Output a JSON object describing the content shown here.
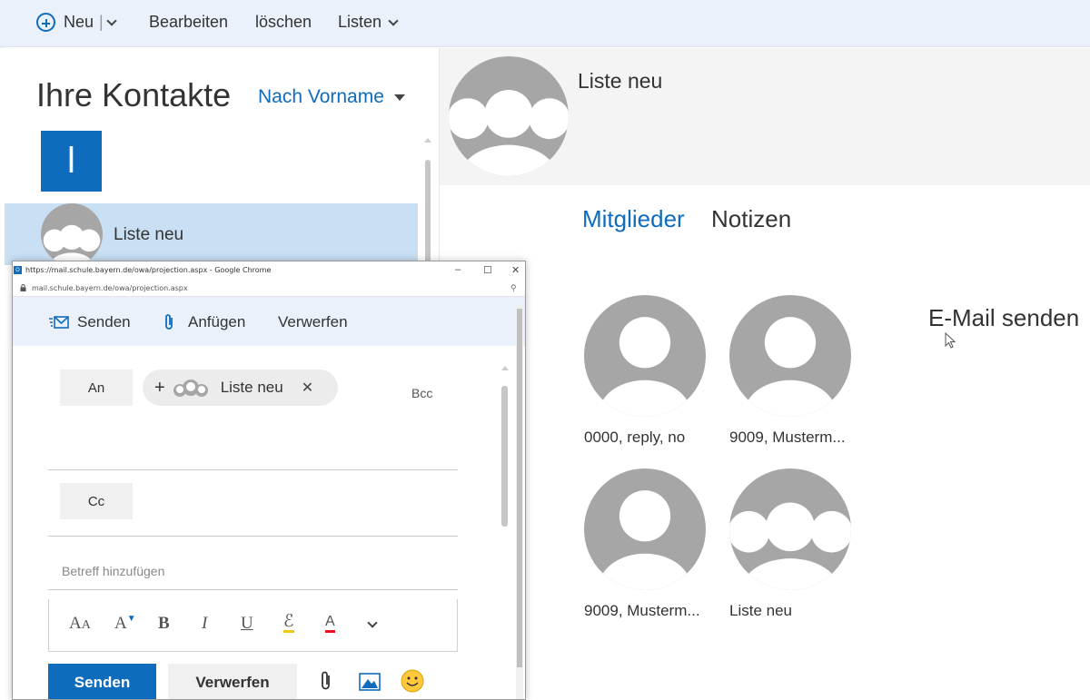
{
  "toolbar": {
    "new_label": "Neu",
    "edit_label": "Bearbeiten",
    "delete_label": "löschen",
    "lists_label": "Listen"
  },
  "contacts": {
    "heading": "Ihre Kontakte",
    "sort_label": "Nach Vorname",
    "letter": "l",
    "items": [
      {
        "name": "Liste neu",
        "avatar": "group-icon"
      }
    ]
  },
  "detail": {
    "title": "Liste neu",
    "tabs": [
      {
        "label": "Mitglieder"
      },
      {
        "label": "Notizen"
      }
    ],
    "send_mail_label": "E-Mail senden",
    "members": [
      {
        "name": "0000, reply, no",
        "avatar": "person-icon"
      },
      {
        "name": "9009, Musterm...",
        "avatar": "person-icon"
      },
      {
        "name": "9009, Musterm...",
        "avatar": "person-icon"
      },
      {
        "name": "Liste neu",
        "avatar": "group-icon"
      }
    ]
  },
  "popup": {
    "window_title": "https://mail.schule.bayern.de/owa/projection.aspx - Google Chrome",
    "url": "mail.schule.bayern.de/owa/projection.aspx",
    "commands": {
      "send": "Senden",
      "attach": "Anfügen",
      "discard": "Verwerfen"
    },
    "to_label": "An",
    "cc_label": "Cc",
    "bcc_label": "Bcc",
    "recipient_chip": "Liste neu",
    "subject_placeholder": "Betreff hinzufügen",
    "send_button": "Senden",
    "discard_button": "Verwerfen",
    "favicon_text": "O"
  },
  "colors": {
    "accent": "#0f6cbd",
    "toolbar_bg": "#eaf1fb",
    "selected_row": "#c9dff4",
    "avatar_gray": "#a6a6a6"
  }
}
